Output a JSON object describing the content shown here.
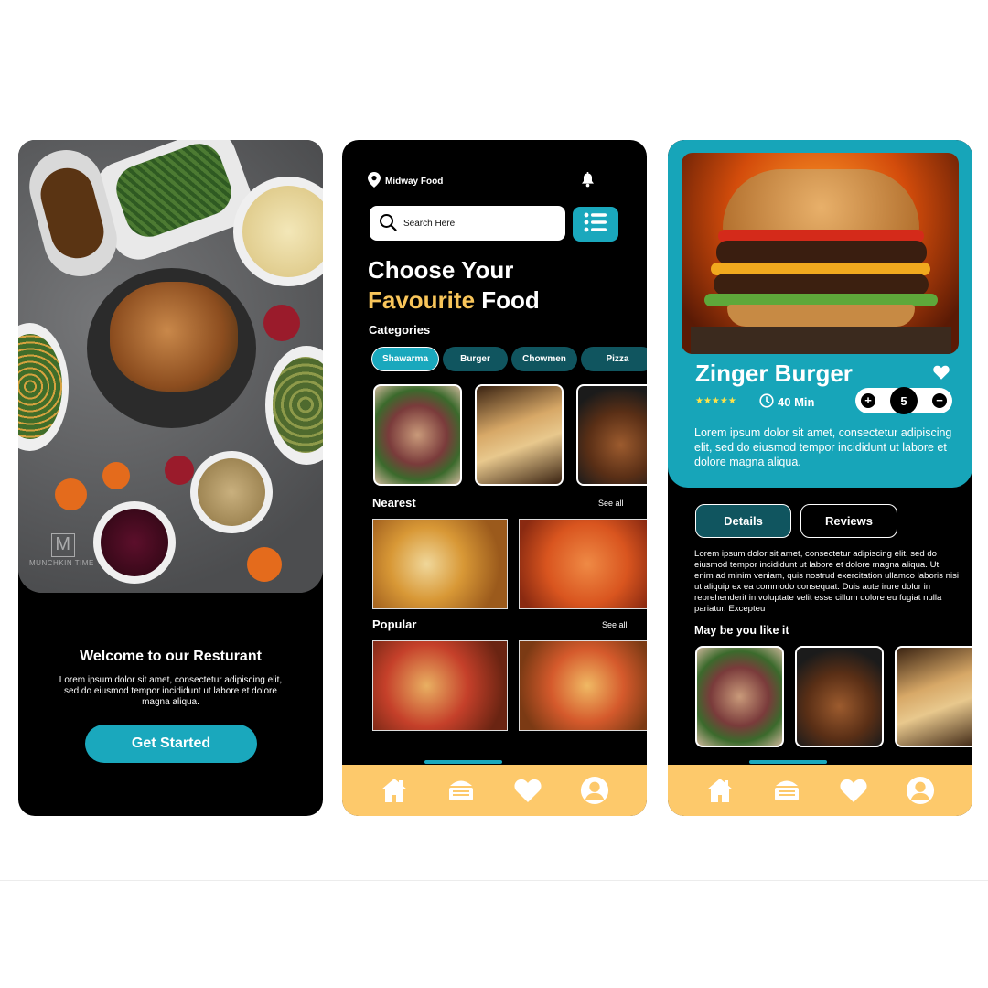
{
  "screen1": {
    "watermark": "MUNCHKIN TIME",
    "watermark_letter": "M",
    "welcome_title": "Welcome to our Resturant",
    "welcome_body": "Lorem ipsum dolor sit amet, consectetur adipiscing elit, sed do eiusmod tempor incididunt ut labore et dolore magna aliqua.",
    "cta_label": "Get Started"
  },
  "screen2": {
    "location": "Midway Food",
    "search_placeholder": "Search Here",
    "heading_line1": "Choose Your",
    "heading_highlight": "Favourite",
    "heading_rest": "Food",
    "categories_title": "Categories",
    "categories": [
      "Shawarma",
      "Burger",
      "Chowmen",
      "Pizza"
    ],
    "active_category": "Shawarma",
    "nearest_title": "Nearest",
    "popular_title": "Popular",
    "see_all": "See all"
  },
  "screen3": {
    "title": "Zinger Burger",
    "rating": "★★★★★",
    "time": "40 Min",
    "quantity": "5",
    "description": "Lorem ipsum dolor sit amet, consectetur adipiscing elit, sed do eiusmod tempor incididunt ut labore et dolore magna aliqua.",
    "tabs": [
      "Details",
      "Reviews"
    ],
    "details_text": "Lorem ipsum dolor sit amet, consectetur adipiscing elit, sed do eiusmod tempor incididunt ut labore et dolore magna aliqua. Ut enim ad minim veniam, quis nostrud exercitation ullamco laboris nisi ut aliquip ex ea commodo consequat. Duis aute irure dolor in reprehenderit in voluptate velit esse cillum dolore eu fugiat nulla pariatur. Excepteu",
    "maybe_title": "May be you like it"
  },
  "nav_icons": [
    "home-icon",
    "menu-icon",
    "heart-icon",
    "profile-icon"
  ],
  "colors": {
    "accent": "#1aa8bd",
    "dark_teal": "#10555f",
    "highlight": "#f8c55a",
    "nav_bg": "#fdc96b",
    "screen_bg": "#000000"
  }
}
